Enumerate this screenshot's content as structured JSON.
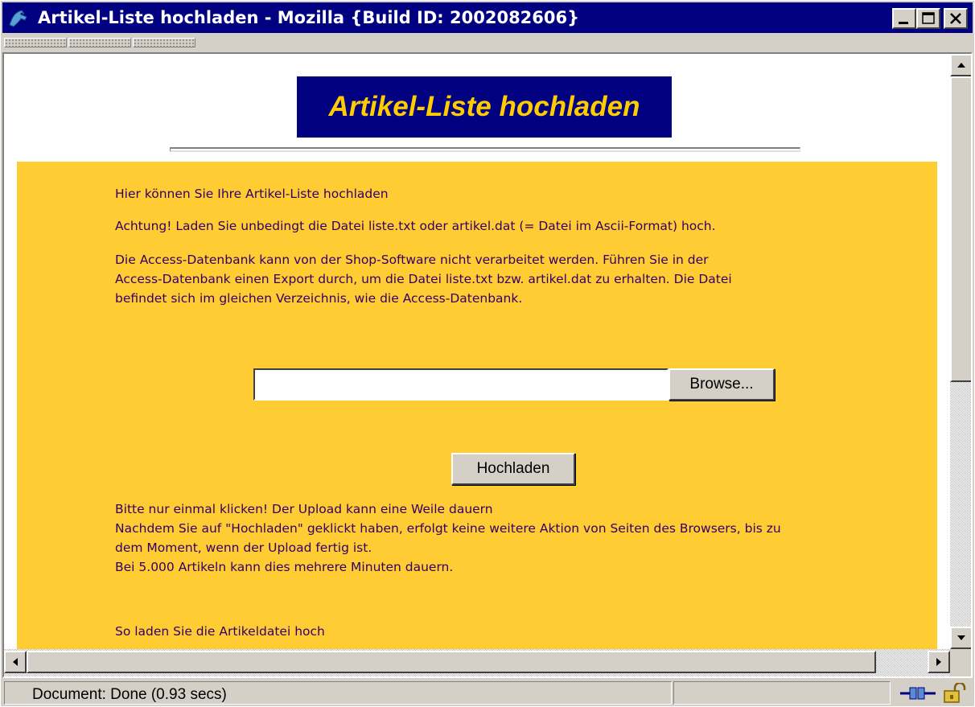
{
  "window": {
    "title": "Artikel-Liste hochladen - Mozilla {Build ID: 2002082606}"
  },
  "page": {
    "banner": "Artikel-Liste hochladen",
    "intro": "Hier können Sie Ihre Artikel-Liste hochladen",
    "warning": "Achtung! Laden Sie unbedingt die Datei liste.txt oder artikel.dat (= Datei im Ascii-Format) hoch.",
    "access_lines": [
      "Die Access-Datenbank kann von der Shop-Software nicht verarbeitet werden. Führen Sie in der",
      "Access-Datenbank einen Export durch, um die Datei liste.txt bzw. artikel.dat zu erhalten. Die Datei",
      "befindet sich im gleichen Verzeichnis, wie die Access-Datenbank."
    ],
    "file_input_value": "",
    "browse_label": "Browse...",
    "upload_label": "Hochladen",
    "notice_lines": [
      "Bitte nur einmal klicken! Der Upload kann eine Weile dauern",
      "Nachdem Sie auf \"Hochladen\" geklickt haben, erfolgt keine weitere Aktion von Seiten des Browsers, bis zu",
      "dem Moment, wenn der Upload fertig ist.",
      "Bei 5.000 Artikeln kann dies mehrere Minuten dauern."
    ],
    "howto": "So laden Sie die Artikeldatei hoch"
  },
  "status": {
    "text": "Document: Done (0.93 secs)"
  },
  "colors": {
    "banner_bg": "#000080",
    "banner_text": "#ffcc00",
    "panel_bg": "#ffcc33",
    "body_text": "#330066"
  },
  "icons": [
    "mozilla-icon",
    "minimize-icon",
    "maximize-icon",
    "close-icon",
    "arrow-up-icon",
    "arrow-down-icon",
    "arrow-left-icon",
    "arrow-right-icon",
    "connection-plug-icon",
    "security-lock-icon"
  ]
}
